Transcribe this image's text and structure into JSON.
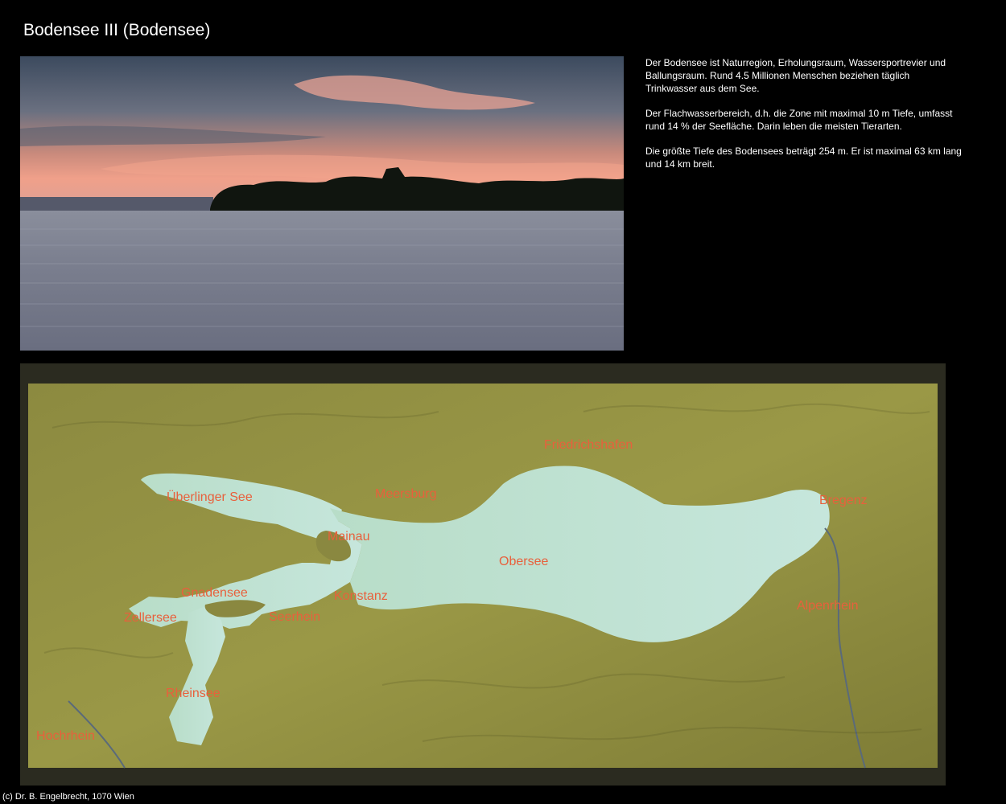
{
  "page": {
    "title": "Bodensee III (Bodensee)",
    "footer": "(c) Dr. B. Engelbrecht, 1070 Wien"
  },
  "description": {
    "paragraphs": [
      "Der Bodensee ist Naturregion, Erholungsraum, Wassersportrevier und Ballungsraum. Rund 4.5 Millionen Menschen beziehen täglich Trinkwasser aus dem See.",
      "Der Flachwasserbereich, d.h. die Zone mit maximal 10 m Tiefe, umfasst rund 14 % der Seefläche. Darin leben die meisten Tierarten.",
      "Die größte Tiefe des Bodensees beträgt 254 m. Er ist maximal 63 km lang und 14 km  breit."
    ]
  },
  "map": {
    "labels": {
      "friedrichshafen": "Friedrichshafen",
      "ueberlinger_see": "Überlinger See",
      "meersburg": "Meersburg",
      "bregenz": "Bregenz",
      "mainau": "Mainau",
      "obersee": "Obersee",
      "gnadensee": "Gnadensee",
      "konstanz": "Konstanz",
      "zellersee": "Zellersee",
      "seerhein": "Seerhein",
      "alpenrhein": "Alpenrhein",
      "rheinsee": "Rheinsee",
      "hochrhein": "Hochrhein"
    }
  },
  "colors": {
    "background": "#000000",
    "text": "#ffffff",
    "map_label": "#e8603c",
    "terrain": "#8a8a3c",
    "lake": "#bfe3d3"
  }
}
